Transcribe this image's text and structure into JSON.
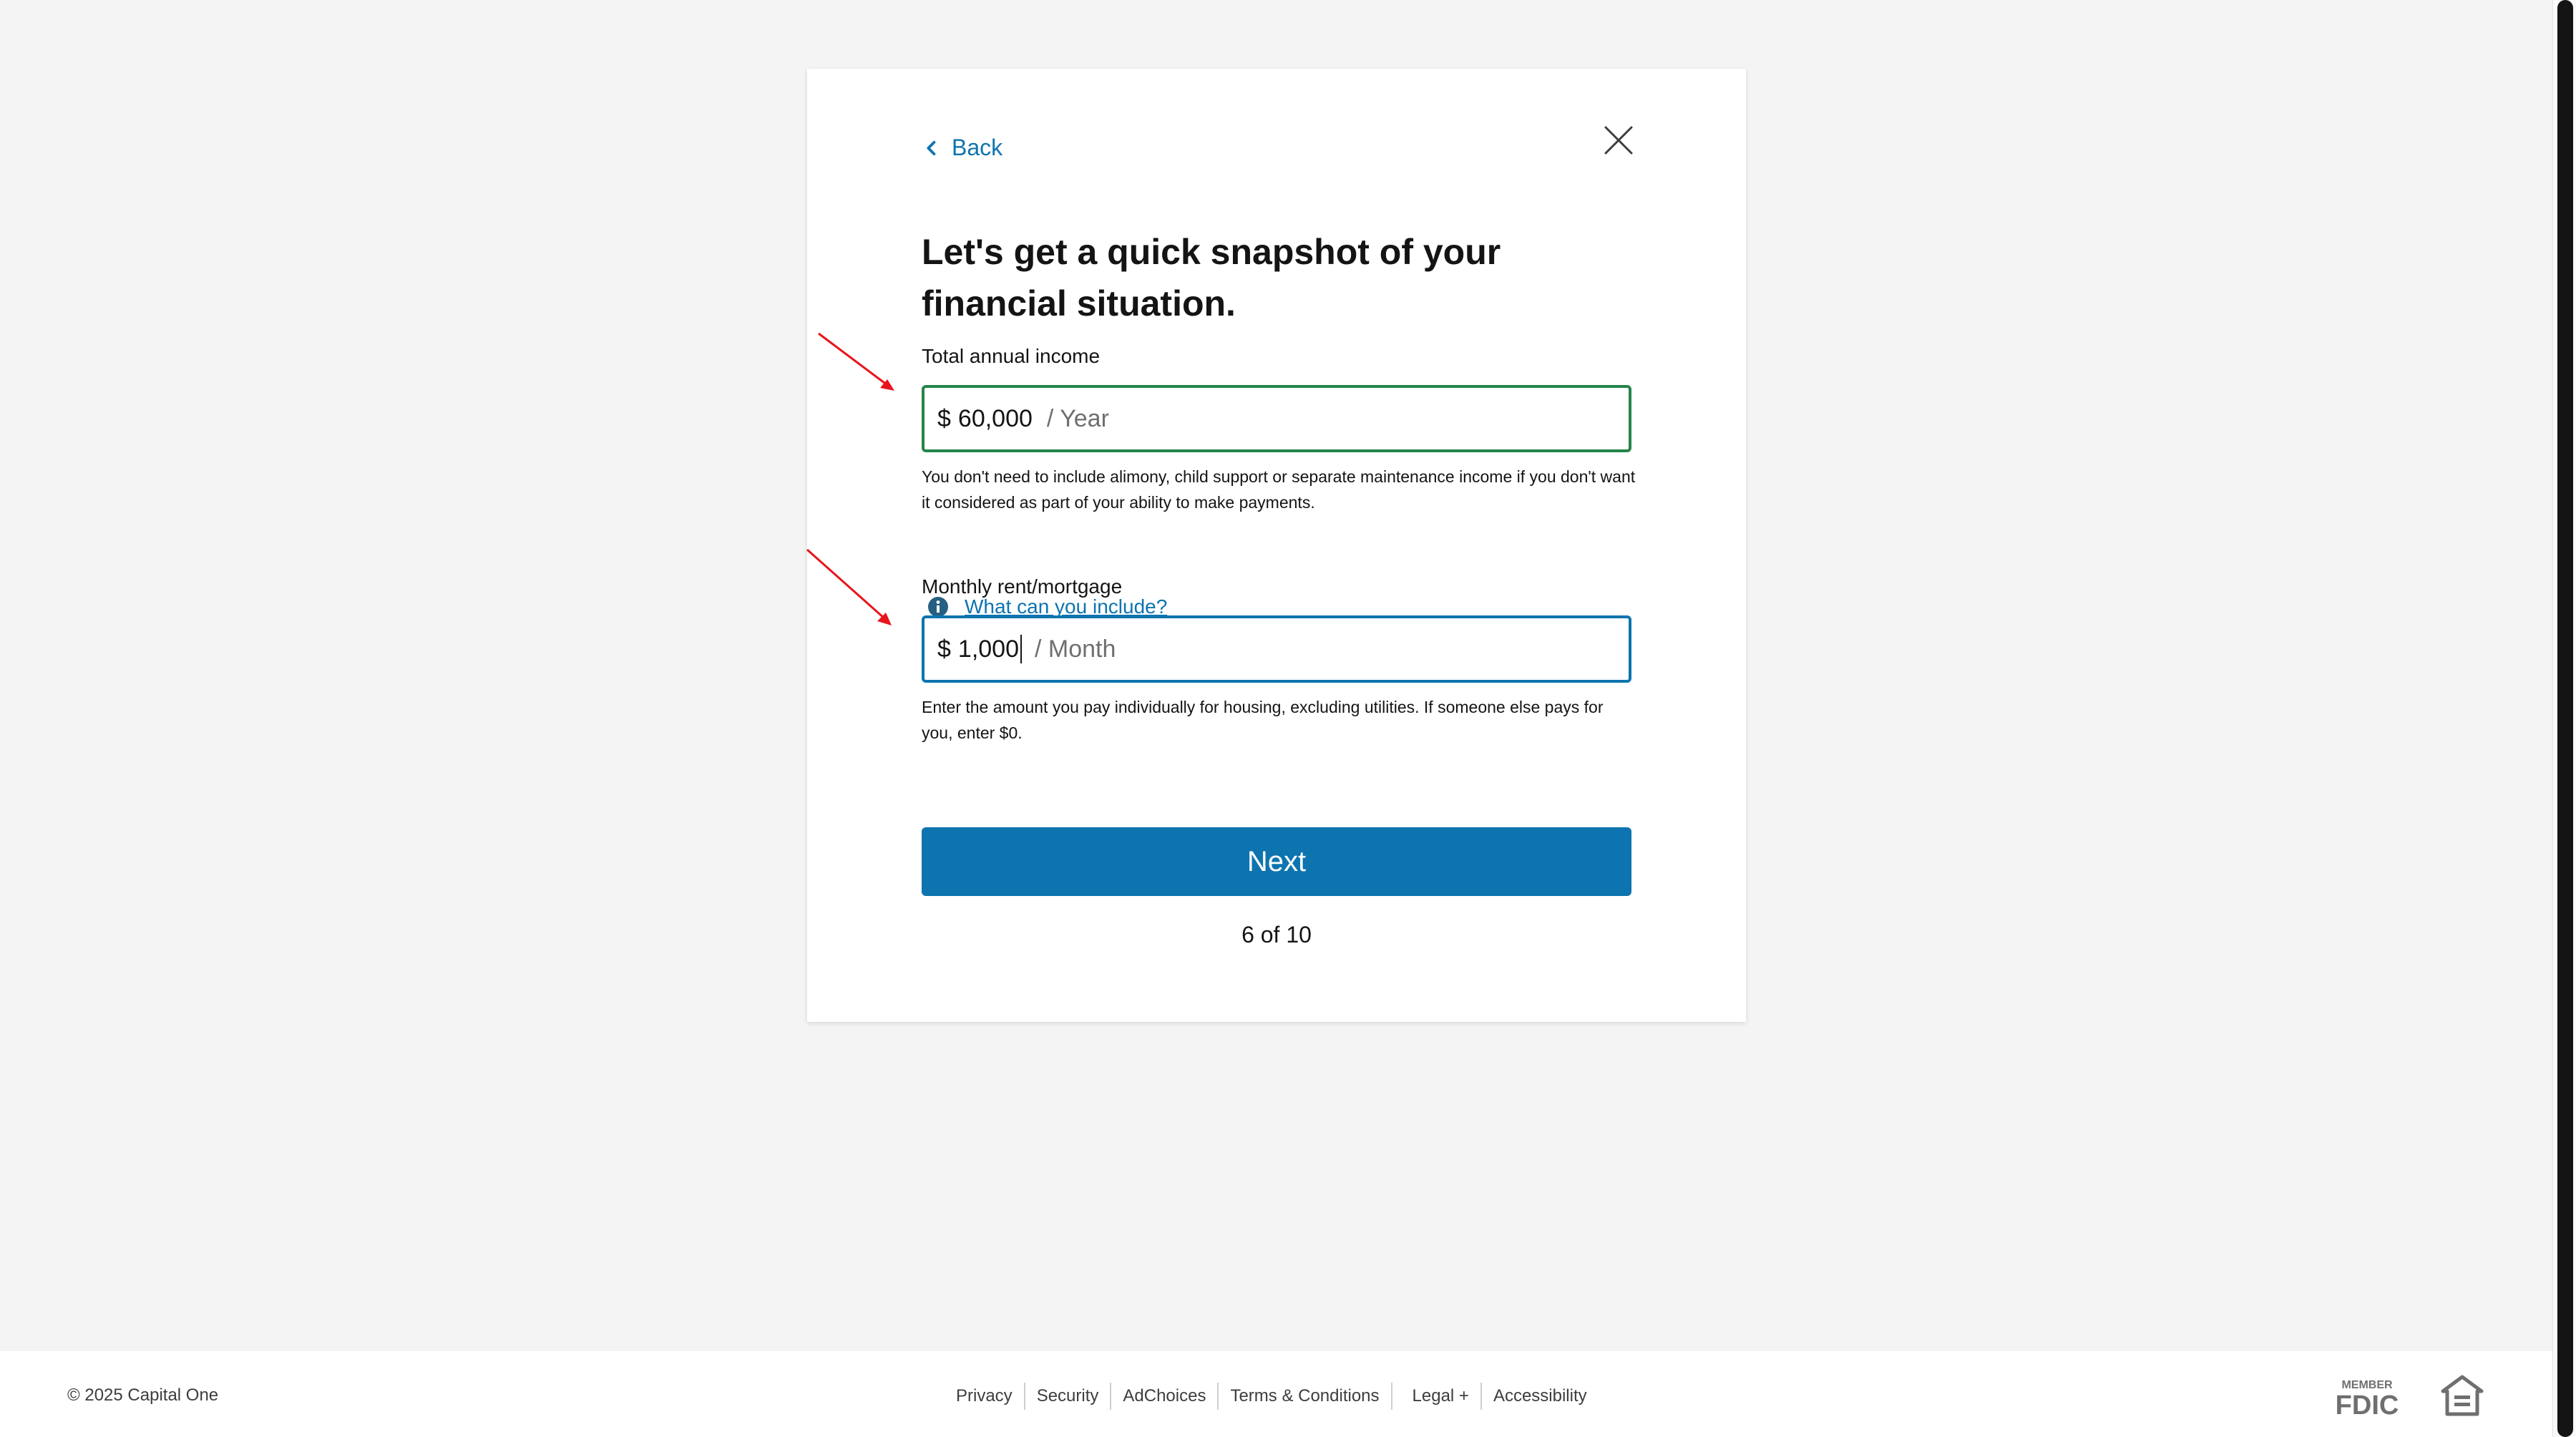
{
  "card": {
    "back_label": "Back",
    "title": "Let's get a quick snapshot of your financial situation.",
    "income": {
      "label": "Total annual income",
      "currency": "$",
      "value": "60,000",
      "suffix": "/ Year",
      "help": "You don't need to include alimony, child support or separate maintenance income if you don't want it considered as part of your ability to make payments.",
      "link": "What can you include?"
    },
    "rent": {
      "label": "Monthly rent/mortgage",
      "currency": "$",
      "value": "1,000",
      "suffix": "/ Month",
      "help": "Enter the amount you pay individually for housing, excluding utilities. If someone else pays for you, enter $0."
    },
    "next_label": "Next",
    "progress": "6 of 10"
  },
  "footer": {
    "copyright": "© 2025 Capital One",
    "links": [
      "Privacy",
      "Security",
      "AdChoices",
      "Terms & Conditions",
      "Legal +",
      "Accessibility"
    ],
    "fdic_line1": "MEMBER",
    "fdic_line2": "FDIC"
  },
  "colors": {
    "accent_blue": "#0d74af",
    "valid_green": "#25854a",
    "annotation_red": "#e8141b"
  },
  "icons": [
    "chevron-left-icon",
    "close-icon",
    "info-icon",
    "fdic-logo",
    "equal-housing-lender-icon"
  ]
}
